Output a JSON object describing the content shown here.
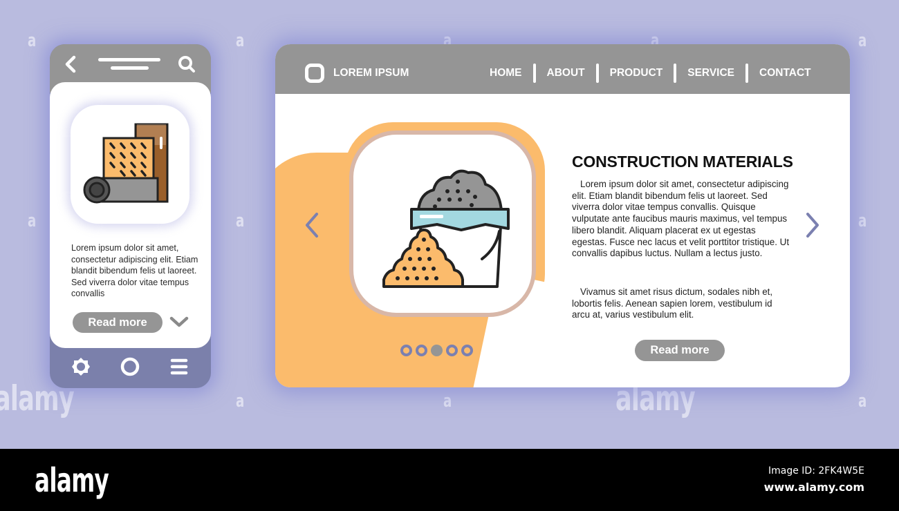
{
  "mobile": {
    "body_text": "Lorem ipsum dolor sit amet, consectetur adipiscing elit. Etiam blandit bibendum felis ut laoreet. Sed viverra dolor vitae tempus convallis",
    "read_more_label": "Read more",
    "icons": {
      "back": "chevron-left-icon",
      "search": "search-icon",
      "illustration": "building-materials-rolls-icon",
      "expand": "chevron-down-icon",
      "settings": "gear-icon",
      "home": "circle-home-icon",
      "menu": "hamburger-menu-icon"
    }
  },
  "desktop": {
    "brand": "LOREM IPSUM",
    "nav": [
      "HOME",
      "ABOUT",
      "PRODUCT",
      "SERVICE",
      "CONTACT"
    ],
    "title": "CONSTRUCTION MATERIALS",
    "paragraph1": "Lorem ipsum dolor sit amet, consectetur adipiscing elit. Etiam blandit bibendum felis ut laoreet. Sed viverra dolor vitae tempus convallis. Quisque vulputate ante faucibus mauris maximus, vel tempus libero blandit. Aliquam placerat ex ut egestas egestas. Fusce nec lacus et velit porttitor tristique. Ut convallis dapibus luctus. Nullam a lectus justo.",
    "paragraph2": "Vivamus sit amet risus dictum, sodales nibh et, lobortis felis. Aenean sapien lorem, vestibulum id arcu at, varius vestibulum elit.",
    "read_more_label": "Read more",
    "carousel": {
      "total_slides": 5,
      "active_slide": 3
    },
    "icons": {
      "logo": "rounded-square-logo-icon",
      "illustration": "cement-bucket-sand-icon",
      "prev": "chevron-left-icon",
      "next": "chevron-right-icon"
    }
  },
  "colors": {
    "background": "#b9bbdf",
    "header_gray": "#959595",
    "accent_orange": "#fbbb6c",
    "accent_purple": "#7b80ab"
  },
  "watermark": {
    "small_mark": "a",
    "big_mark": "alamy"
  },
  "footer": {
    "logo": "alamy",
    "image_id": "Image ID: 2FK4W5E",
    "url": "www.alamy.com"
  }
}
